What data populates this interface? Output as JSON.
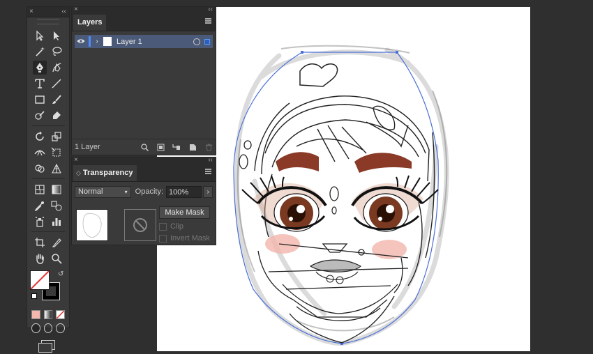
{
  "tools_panel": {
    "close_glyph": "×",
    "collapse_glyph": "‹‹"
  },
  "layers_panel": {
    "tab_label": "Layers",
    "close_glyph": "×",
    "collapse_glyph": "‹‹",
    "layer": {
      "name": "Layer 1",
      "color": "#4f8cff"
    },
    "footer_count": "1 Layer"
  },
  "transparency_panel": {
    "tab_label": "Transparency",
    "tab_prefix": "◇",
    "close_glyph": "×",
    "collapse_glyph": "‹‹",
    "blend_mode": "Normal",
    "opacity_label": "Opacity:",
    "opacity_value": "100%",
    "make_mask_label": "Make Mask",
    "clip_label": "Clip",
    "invert_mask_label": "Invert Mask"
  },
  "colors": {
    "brow": "#8a3a26",
    "iris": "#5a2a16",
    "blush": "#f3b7ad",
    "selection": "#4a6fd8",
    "fill_swatch": "#ffffff",
    "stroke_swatch": "#000000"
  }
}
